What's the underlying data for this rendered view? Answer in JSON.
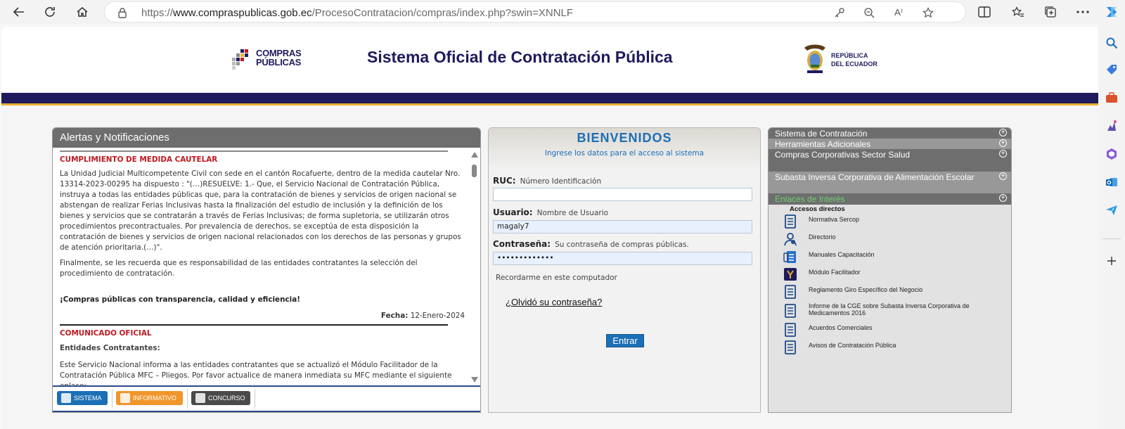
{
  "browser": {
    "url_prefix": "https://",
    "url_host": "www.compraspublicas.gob.ec",
    "url_path": "/ProcesoContratacion/compras/index.php?swin=XNNLF",
    "reader_label": "A⁾"
  },
  "header": {
    "title": "Sistema Oficial de Contratación Pública",
    "logo_line1": "COMPRAS",
    "logo_line2": "PÚBLICAS",
    "republic_line1": "REPÚBLICA",
    "republic_line2": "DEL ECUADOR"
  },
  "alerts": {
    "heading": "Alertas y Notificaciones",
    "notice1_title": "CUMPLIMIENTO DE MEDIDA CAUTELAR",
    "notice1_p1": "La Unidad Judicial Multicompetente Civil con sede en el cantón Rocafuerte, dentro de la medida cautelar Nro. 13314-2023-00295 ha dispuesto : \"(…)RESUELVE: 1.- Que, el Servicio Nacional de Contratación Pública, instruya a todas las entidades públicas que, para la contratación de bienes y servicios de origen nacional se abstengan de realizar Ferias Inclusivas hasta la finalización del estudio de inclusión y la definición de los bienes y servicios que se contratarán a través de Ferias Inclusivas; de forma supletoria, se utilizarán otros procedimientos precontractuales. Por prevalencia de derechos, se exceptúa de esta disposición la contratación de bienes y servicios de origen nacional relacionados con los derechos de las personas y grupos de atención prioritaria.(…)\".",
    "notice1_p2": "Finalmente, se les recuerda que es responsabilidad de las entidades contratantes la selección del procedimiento de contratación.",
    "slogan": "¡Compras públicas con transparencia, calidad y eficiencia!",
    "fecha_label": "Fecha:",
    "fecha_value": "12-Enero-2024",
    "notice2_title": "COMUNICADO OFICIAL",
    "notice2_sub": "Entidades Contratantes:",
    "notice2_p1": "Este Servicio Nacional informa a las entidades contratantes que se actualizó el Módulo Facilitador de la Contratación Pública MFC – Pliegos. Por favor actualice de manera inmediata su MFC mediante el siguiente enlace:",
    "tabs": [
      {
        "label": "SISTEMA",
        "color": "#1c6fb5"
      },
      {
        "label": "INFORMATIVO",
        "color": "#f0962a"
      },
      {
        "label": "CONCURSO",
        "color": "#4a4a4a"
      }
    ]
  },
  "login": {
    "welcome": "BIENVENIDOS",
    "subtitle": "Ingrese los datos para el acceso al sistema",
    "ruc_label": "RUC:",
    "ruc_hint": "Número Identificación",
    "ruc_value": "",
    "user_label": "Usuario:",
    "user_hint": "Nombre de Usuario",
    "user_value": "magaly7",
    "pass_label": "Contraseña:",
    "pass_hint": "Su contraseña de compras públicas.",
    "pass_value": "•••••••••••••",
    "remember": "Recordarme en este computador",
    "forgot": "¿Olvidó su contraseña?",
    "submit": "Entrar"
  },
  "menu": {
    "items": [
      "Sistema de Contratación",
      "Herramientas Adicionales",
      "Compras Corporativas Sector Salud",
      "Subasta Inversa Corporativa de Alimentación Escolar",
      "Enlaces de Interés"
    ],
    "plus": "+",
    "accesos_title": "Accesos directos",
    "accesos": [
      "Normativa Sercop",
      "Directorio",
      "Manuales Capacitación",
      "Módulo Facilitador",
      "Reglamento Giro Específico del Negocio",
      "Informe de la CGE sobre Subasta Inversa Corporativa de Medicamentos 2016",
      "Acuerdos Comerciales",
      "Avisos de Contratación Pública"
    ]
  },
  "colors": {
    "navy": "#1e1b5c",
    "accent_blue": "#1c6fb5",
    "alert_red": "#c0181f",
    "panel_gray": "#6e6e6e",
    "gold": "#e8b030"
  }
}
